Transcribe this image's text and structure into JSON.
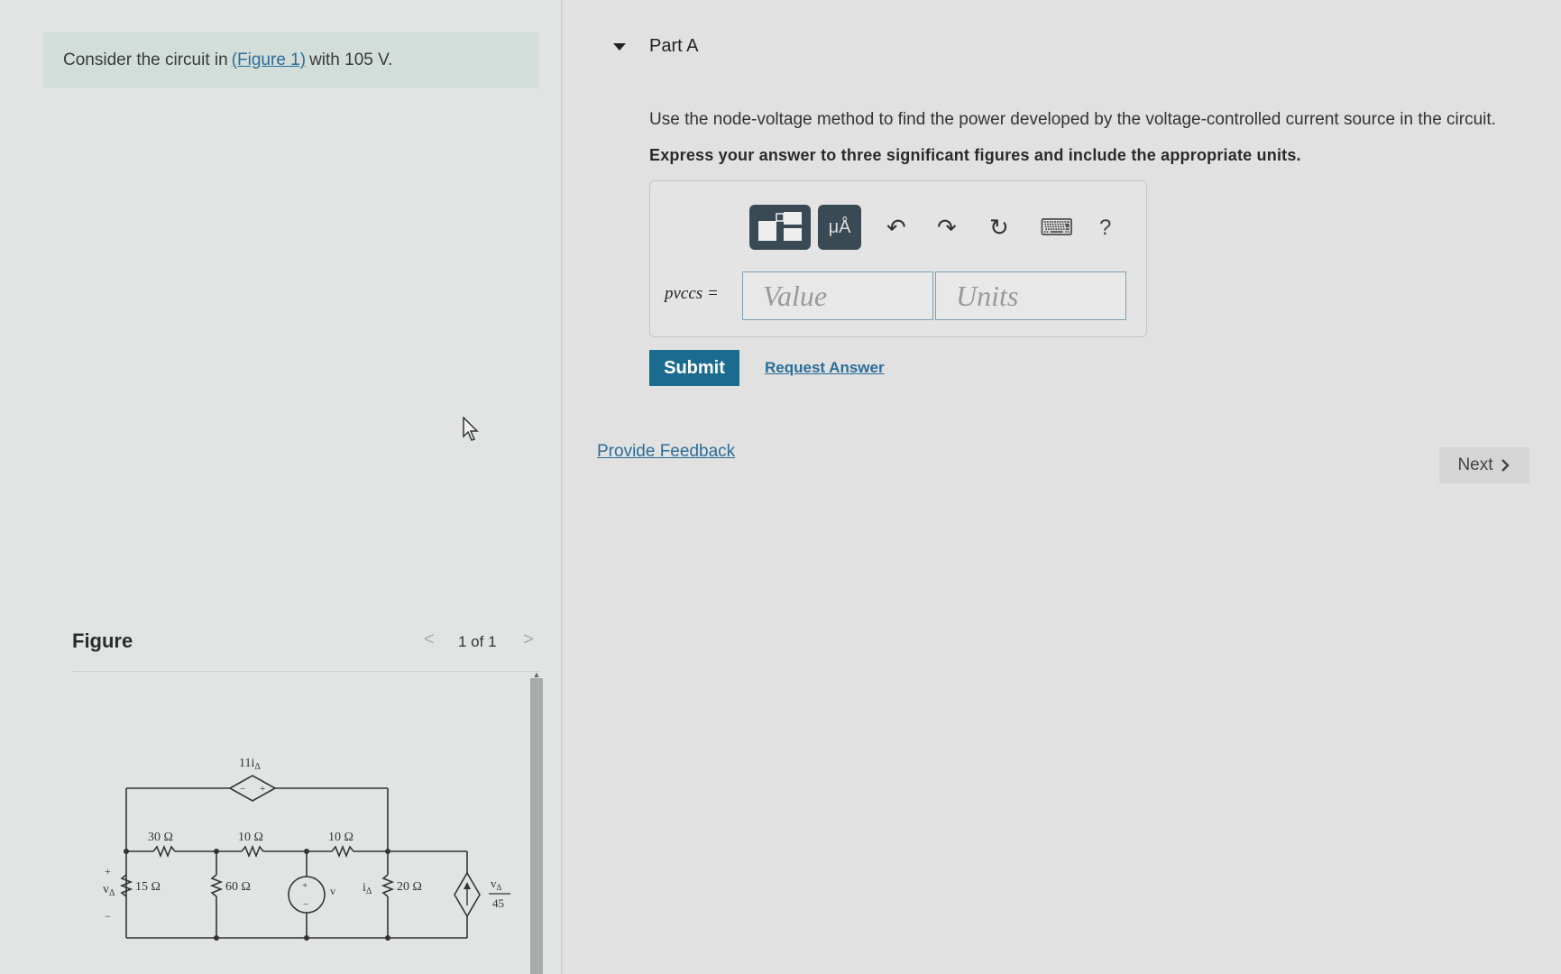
{
  "problem": {
    "prefix": "Consider the circuit in",
    "figure_link": "(Figure 1)",
    "suffix": "with 105 V."
  },
  "figure": {
    "title": "Figure",
    "prev": "<",
    "counter": "1 of 1",
    "next": ">",
    "labels": {
      "dependent_voltage": "11i",
      "dependent_voltage_sub": "Δ",
      "r30": "30 Ω",
      "r10a": "10 Ω",
      "r10b": "10 Ω",
      "r15": "15 Ω",
      "r60": "60 Ω",
      "r20": "20 Ω",
      "v_delta": "v",
      "v_delta_sub": "Δ",
      "source_v": "v",
      "i_delta": "i",
      "i_delta_sub": "Δ",
      "plus": "+",
      "minus": "−",
      "ccs_num": "v",
      "ccs_num_sub": "Δ",
      "ccs_den": "45"
    }
  },
  "part": {
    "title": "Part A",
    "instruction": "Use the node-voltage method to find the power developed by the voltage-controlled current source in the circuit.",
    "instruction_bold": "Express your answer to three significant figures and include the appropriate units."
  },
  "answer": {
    "toolbar": {
      "templates_icon": "templates-icon",
      "units_label": "μÅ",
      "undo": "↶",
      "redo": "↷",
      "reset": "↻",
      "keyboard": "⌨",
      "help": "?"
    },
    "label": "pvccs =",
    "value_placeholder": "Value",
    "units_placeholder": "Units"
  },
  "actions": {
    "submit": "Submit",
    "request_answer": "Request Answer",
    "provide_feedback": "Provide Feedback",
    "next": "Next"
  }
}
